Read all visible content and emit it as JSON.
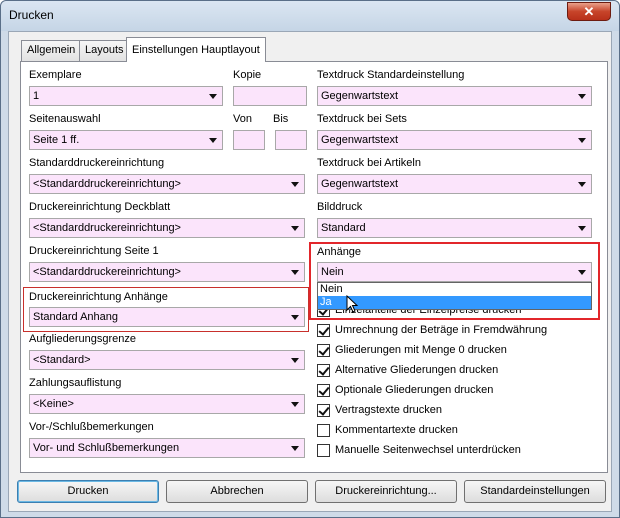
{
  "window": {
    "title": "Drucken",
    "close_glyph": "✕"
  },
  "tabs": [
    {
      "label": "Allgemein"
    },
    {
      "label": "Layouts"
    },
    {
      "label": "Einstellungen Hauptlayout"
    }
  ],
  "left": {
    "exemplare": {
      "label": "Exemplare",
      "value": "1"
    },
    "kopie": {
      "label": "Kopie",
      "value": ""
    },
    "seitenauswahl": {
      "label": "Seitenauswahl",
      "value": "Seite 1 ff."
    },
    "von": {
      "label": "Von",
      "value": ""
    },
    "bis": {
      "label": "Bis",
      "value": ""
    },
    "standarddrucker": {
      "label": "Standarddruckereinrichtung",
      "value": "<Standarddruckereinrichtung>"
    },
    "deckblatt": {
      "label": "Druckereinrichtung Deckblatt",
      "value": "<Standarddruckereinrichtung>"
    },
    "seite1": {
      "label": "Druckereinrichtung Seite 1",
      "value": "<Standarddruckereinrichtung>"
    },
    "anhaenge": {
      "label": "Druckereinrichtung Anhänge",
      "value": "Standard Anhang"
    },
    "gliederungsgrenze": {
      "label": "Aufgliederungsgrenze",
      "value": "<Standard>"
    },
    "zahlungsauflistung": {
      "label": "Zahlungsauflistung",
      "value": "<Keine>"
    },
    "vorschluss": {
      "label": "Vor-/Schlußbemerkungen",
      "value": "Vor- und Schlußbemerkungen"
    }
  },
  "right": {
    "textdruck_standard": {
      "label": "Textdruck Standardeinstellung",
      "value": "Gegenwartstext"
    },
    "textdruck_sets": {
      "label": "Textdruck bei Sets",
      "value": "Gegenwartstext"
    },
    "textdruck_artikeln": {
      "label": "Textdruck bei Artikeln",
      "value": "Gegenwartstext"
    },
    "bilddruck": {
      "label": "Bilddruck",
      "value": "Standard"
    },
    "anhaenge": {
      "label": "Anhänge",
      "value": "Nein",
      "options": [
        "Nein",
        "Ja"
      ],
      "highlighted": "Ja"
    },
    "hidden_checkbox_text": "Einzelanteile der Einzelpreise drucken"
  },
  "checkboxes": [
    {
      "label": "Umrechnung der Beträge in Fremdwährung",
      "checked": true
    },
    {
      "label": "Gliederungen mit Menge 0 drucken",
      "checked": true
    },
    {
      "label": "Alternative Gliederungen drucken",
      "checked": true
    },
    {
      "label": "Optionale Gliederungen drucken",
      "checked": true
    },
    {
      "label": "Vertragstexte drucken",
      "checked": true
    },
    {
      "label": "Kommentartexte drucken",
      "checked": false
    },
    {
      "label": "Manuelle Seitenwechsel unterdrücken",
      "checked": false
    }
  ],
  "buttons": {
    "print": "Drucken",
    "cancel": "Abbrechen",
    "printer_setup": "Druckereinrichtung...",
    "defaults": "Standardeinstellungen"
  },
  "colors": {
    "field_bg": "#fbe4fb",
    "highlight_border": "#e2262b",
    "selection": "#3399ff"
  }
}
